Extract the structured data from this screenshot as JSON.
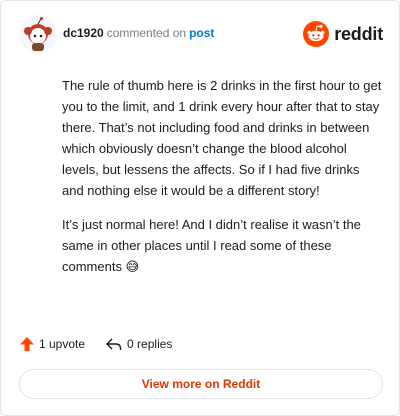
{
  "comment": {
    "username": "dc1920",
    "action": "commented on",
    "target": "post",
    "paragraphs": [
      "The rule of thumb here is 2 drinks in the first hour to get you to the limit, and 1 drink every hour after that to stay there. That’s not including food and drinks in between which obviously doesn’t change the blood alcohol levels, but lessens the affects. So if I had five drinks and nothing else it would be a different story!",
      "It’s just normal here! And I didn’t realise it wasn’t the same in other places until I read some of these comments 😅"
    ]
  },
  "brand": {
    "name": "reddit",
    "color": "#ff4500"
  },
  "footer": {
    "upvotes": "1 upvote",
    "replies": "0 replies"
  },
  "cta": {
    "label": "View more on Reddit",
    "color": "#d93900"
  },
  "icons": {
    "avatar": "snoo-avatar",
    "brand": "reddit-logo-icon",
    "upvote": "upvote-arrow-icon",
    "reply": "reply-arrow-icon"
  }
}
